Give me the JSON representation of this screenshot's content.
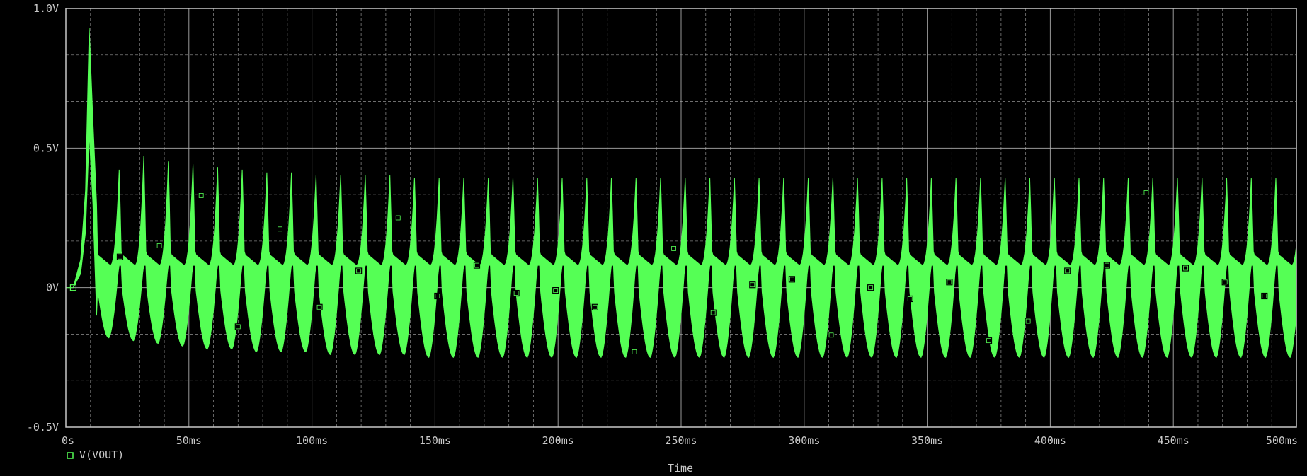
{
  "colors": {
    "background": "#000000",
    "trace": "#55ff55",
    "grid": "#b4b4b4",
    "frame": "#c8c8c8",
    "text": "#c8c8c8"
  },
  "chart_data": {
    "type": "line",
    "xlabel": "Time",
    "ylabel": "",
    "xlim": [
      0,
      0.5
    ],
    "ylim": [
      -0.5,
      1.0
    ],
    "x_ticks": [
      0,
      0.05,
      0.1,
      0.15,
      0.2,
      0.25,
      0.3,
      0.35,
      0.4,
      0.45,
      0.5
    ],
    "x_tick_labels": [
      "0s",
      "50ms",
      "100ms",
      "150ms",
      "200ms",
      "250ms",
      "300ms",
      "350ms",
      "400ms",
      "450ms",
      "500ms"
    ],
    "y_ticks": [
      -0.5,
      0,
      0.5,
      1.0
    ],
    "y_tick_labels": [
      "-0.5V",
      "0V",
      "0.5V",
      "1.0V"
    ],
    "grid": true,
    "grid_style": "dashed",
    "legend_position": "bottom-left",
    "series": [
      {
        "name": "V(VOUT)",
        "marker": "square",
        "band": {
          "description_values": "upper and lower envelope of dense oscillation, in volts",
          "startup": [
            {
              "x": 0.0,
              "lo": 0.0,
              "hi": 0.0
            },
            {
              "x": 0.003,
              "lo": 0.0,
              "hi": 0.0
            },
            {
              "x": 0.006,
              "lo": 0.05,
              "hi": 0.1
            },
            {
              "x": 0.008,
              "lo": 0.2,
              "hi": 0.35
            },
            {
              "x": 0.0095,
              "lo": 0.55,
              "hi": 0.93
            },
            {
              "x": 0.011,
              "lo": 0.3,
              "hi": 0.6
            },
            {
              "x": 0.0125,
              "lo": -0.1,
              "hi": 0.3
            }
          ],
          "periodic_start": 0.0125,
          "period": 0.01,
          "peak_high": [
            0.43,
            0.48,
            0.46,
            0.45,
            0.44,
            0.43,
            0.42,
            0.42,
            0.41,
            0.41,
            0.41,
            0.41,
            0.4,
            0.4,
            0.4,
            0.4,
            0.4,
            0.4,
            0.4,
            0.4,
            0.4,
            0.4,
            0.4,
            0.4,
            0.4,
            0.4,
            0.4,
            0.4,
            0.4,
            0.4,
            0.4,
            0.4,
            0.4,
            0.4,
            0.4,
            0.4,
            0.4,
            0.4,
            0.4,
            0.4,
            0.4,
            0.4,
            0.4,
            0.4,
            0.4,
            0.4,
            0.4,
            0.4,
            0.4
          ],
          "trough_low": [
            -0.18,
            -0.19,
            -0.2,
            -0.21,
            -0.22,
            -0.22,
            -0.23,
            -0.23,
            -0.23,
            -0.24,
            -0.24,
            -0.24,
            -0.24,
            -0.25,
            -0.25,
            -0.25,
            -0.25,
            -0.25,
            -0.25,
            -0.25,
            -0.25,
            -0.25,
            -0.25,
            -0.25,
            -0.25,
            -0.25,
            -0.25,
            -0.25,
            -0.25,
            -0.25,
            -0.25,
            -0.25,
            -0.25,
            -0.25,
            -0.25,
            -0.25,
            -0.25,
            -0.25,
            -0.25,
            -0.25,
            -0.25,
            -0.25,
            -0.25,
            -0.25,
            -0.25,
            -0.25,
            -0.25,
            -0.25,
            -0.25
          ],
          "baseline_high": 0.08,
          "baseline_low": 0.02
        },
        "markers": [
          {
            "x": 0.003,
            "y": 0.0
          },
          {
            "x": 0.022,
            "y": 0.11
          },
          {
            "x": 0.038,
            "y": 0.15
          },
          {
            "x": 0.055,
            "y": 0.33
          },
          {
            "x": 0.07,
            "y": -0.14
          },
          {
            "x": 0.087,
            "y": 0.21
          },
          {
            "x": 0.103,
            "y": -0.07
          },
          {
            "x": 0.119,
            "y": 0.06
          },
          {
            "x": 0.135,
            "y": 0.25
          },
          {
            "x": 0.151,
            "y": -0.03
          },
          {
            "x": 0.167,
            "y": 0.08
          },
          {
            "x": 0.183,
            "y": -0.02
          },
          {
            "x": 0.199,
            "y": -0.01
          },
          {
            "x": 0.215,
            "y": -0.07
          },
          {
            "x": 0.231,
            "y": -0.23
          },
          {
            "x": 0.247,
            "y": 0.14
          },
          {
            "x": 0.263,
            "y": -0.09
          },
          {
            "x": 0.279,
            "y": 0.01
          },
          {
            "x": 0.295,
            "y": 0.03
          },
          {
            "x": 0.311,
            "y": -0.17
          },
          {
            "x": 0.327,
            "y": 0.0
          },
          {
            "x": 0.343,
            "y": -0.04
          },
          {
            "x": 0.359,
            "y": 0.02
          },
          {
            "x": 0.375,
            "y": -0.19
          },
          {
            "x": 0.391,
            "y": -0.12
          },
          {
            "x": 0.407,
            "y": 0.06
          },
          {
            "x": 0.423,
            "y": 0.08
          },
          {
            "x": 0.439,
            "y": 0.34
          },
          {
            "x": 0.455,
            "y": 0.07
          },
          {
            "x": 0.471,
            "y": 0.02
          },
          {
            "x": 0.487,
            "y": -0.03
          }
        ]
      }
    ]
  }
}
